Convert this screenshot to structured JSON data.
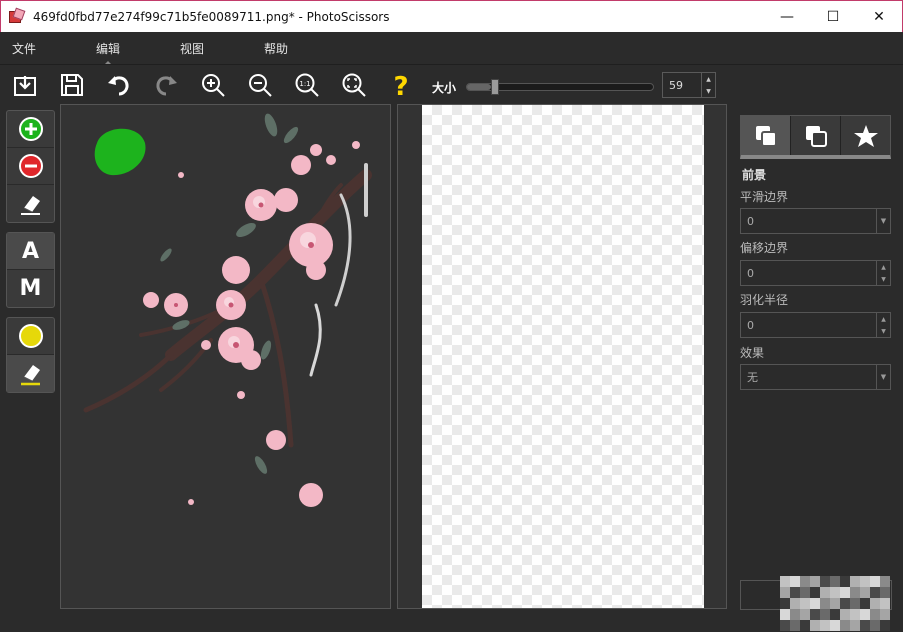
{
  "window": {
    "title": "469fd0fbd77e274f99c71b5fe0089711.png* - PhotoScissors",
    "minimize": "—",
    "maximize": "☐",
    "close": "✕"
  },
  "menu": {
    "items": [
      {
        "label": "文件"
      },
      {
        "label": "编辑"
      },
      {
        "label": "视图"
      },
      {
        "label": "帮助"
      }
    ]
  },
  "toolbar": {
    "size_label": "大小",
    "size_value": "59",
    "size_fraction": 0.13
  },
  "palette": {
    "auto_label": "A",
    "manual_label": "M"
  },
  "right_panel": {
    "section_title": "前景",
    "smooth_label": "平滑边界",
    "smooth_value": "0",
    "offset_label": "偏移边界",
    "offset_value": "0",
    "feather_label": "羽化半径",
    "feather_value": "0",
    "effect_label": "效果",
    "effect_value": "无"
  },
  "colors": {
    "keep_marker": "#1db31d",
    "remove_marker": "#e0262b",
    "background_marker": "#e6d80a",
    "help_icon": "#ffd800",
    "flower_pink": "#f3b8c6",
    "branch_brown": "#4a3330"
  }
}
